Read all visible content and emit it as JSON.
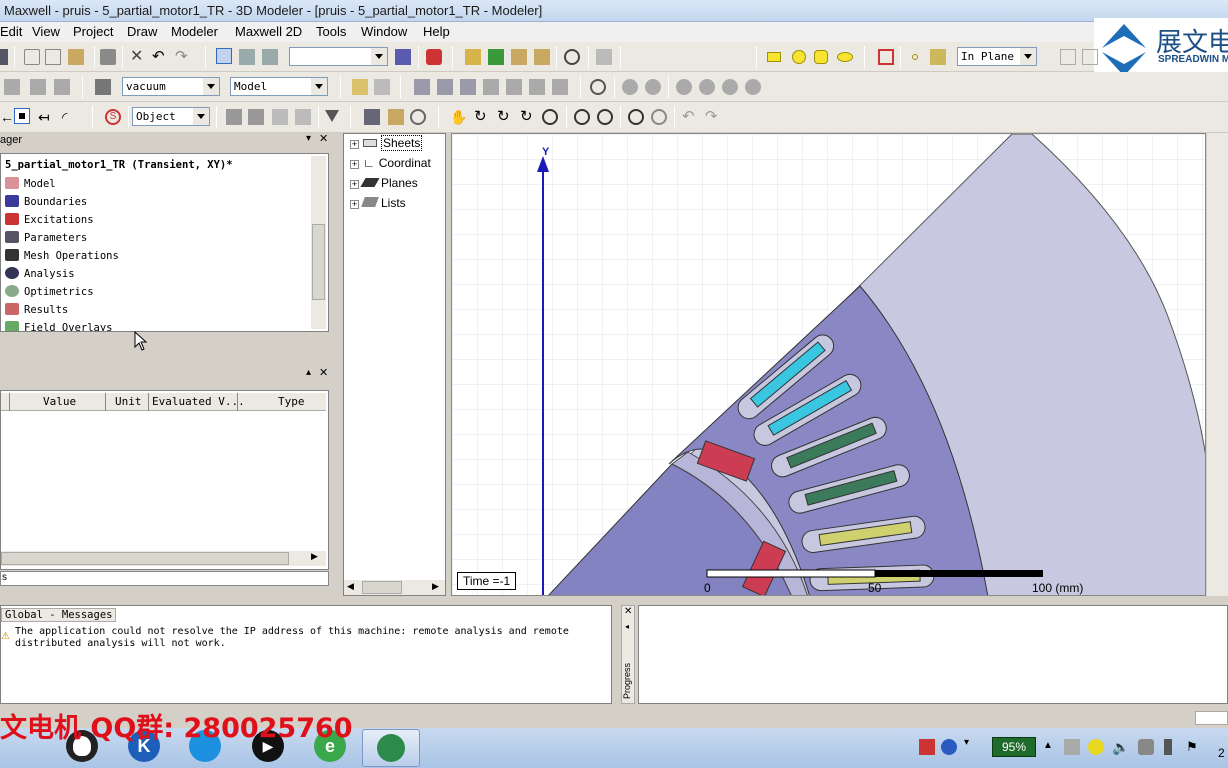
{
  "window": {
    "title": "Maxwell - pruis - 5_partial_motor1_TR - 3D Modeler - [pruis - 5_partial_motor1_TR - Modeler]"
  },
  "logo": {
    "text": "展文电",
    "subtext": "SPREADWIN M"
  },
  "menu": [
    "Edit",
    "View",
    "Project",
    "Draw",
    "Modeler",
    "Maxwell 2D",
    "Tools",
    "Window",
    "Help"
  ],
  "toolbar": {
    "blank_combo": "",
    "material": "vacuum",
    "model_combo": "Model",
    "plane_combo": "In Plane",
    "select_combo": "Object"
  },
  "project_manager": {
    "title": "ager",
    "root": "5_partial_motor1_TR (Transient, XY)*",
    "items": [
      "Model",
      "Boundaries",
      "Excitations",
      "Parameters",
      "Mesh Operations",
      "Analysis",
      "Optimetrics",
      "Results",
      "Field Overlays"
    ]
  },
  "properties": {
    "columns": [
      "Value",
      "Unit",
      "Evaluated V...",
      "Type"
    ],
    "tab": "s"
  },
  "model_tree": {
    "items": [
      "Sheets",
      "Coordinat",
      "Planes",
      "Lists"
    ]
  },
  "viewport": {
    "axis_label": "Y",
    "time_label": "Time =-1",
    "scale_labels": [
      "0",
      "50",
      "100 (mm)"
    ]
  },
  "messages": {
    "tab": "Global - Messages",
    "text_line1": "The application could not resolve the IP address of this machine: remote analysis and remote",
    "text_line2": "distributed analysis will not work."
  },
  "progress": {
    "label": "Progress"
  },
  "watermark": "文电机 QQ群: 280025760",
  "tray": {
    "battery": "95%",
    "clock_partial": "2"
  },
  "colors": {
    "stator": "#8a89c8",
    "air": "#c7c7e0",
    "magnet": "#cc3c52",
    "coil_cyan": "#38c6e0",
    "coil_green": "#3b7a5a",
    "coil_yellow": "#cfd06e",
    "axis": "#1a1ab8"
  }
}
